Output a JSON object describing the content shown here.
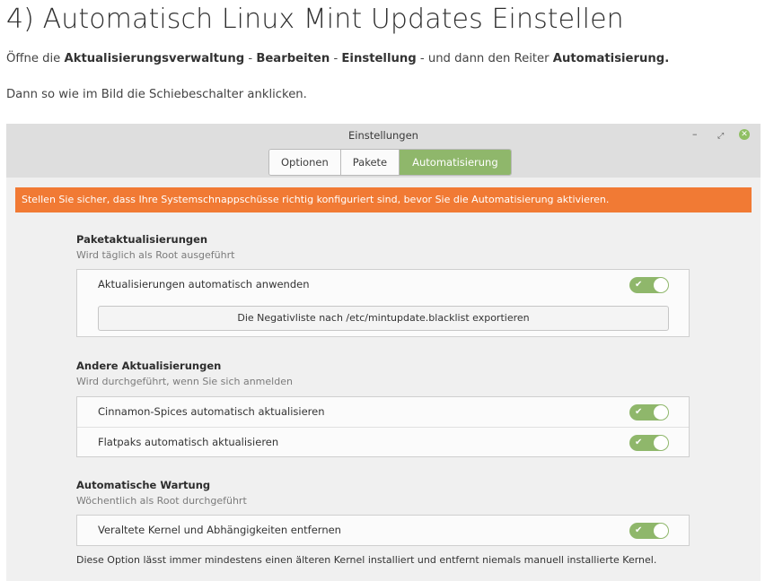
{
  "article": {
    "heading": "4) Automatisch Linux Mint Updates Einstellen",
    "paragraph1": {
      "t1": "Öffne die ",
      "b1": "Aktualisierungsverwaltung",
      "t2": " -  ",
      "b2": "Bearbeiten",
      "t3": " - ",
      "b3": "Einstellung",
      "t4": " - und dann den Reiter ",
      "b4": "Automatisierung."
    },
    "paragraph2": "Dann so wie im Bild die Schiebeschalter anklicken."
  },
  "window": {
    "title": "Einstellungen",
    "controls": {
      "minimize": "–",
      "maximize": "⤢",
      "close": "✕"
    },
    "tabs": [
      {
        "label": "Optionen",
        "active": false
      },
      {
        "label": "Pakete",
        "active": false
      },
      {
        "label": "Automatisierung",
        "active": true
      }
    ],
    "warning": "Stellen Sie sicher, dass Ihre Systemschnappschüsse richtig konfiguriert sind, bevor Sie die Automatisierung aktivieren.",
    "sections": [
      {
        "title": "Paketaktualisierungen",
        "subtitle": "Wird täglich als Root ausgeführt",
        "rows": [
          {
            "label": "Aktualisierungen automatisch anwenden",
            "enabled": true
          }
        ],
        "button": "Die Negativliste nach /etc/mintupdate.blacklist exportieren"
      },
      {
        "title": "Andere Aktualisierungen",
        "subtitle": "Wird durchgeführt, wenn Sie sich anmelden",
        "rows": [
          {
            "label": "Cinnamon-Spices automatisch aktualisieren",
            "enabled": true
          },
          {
            "label": "Flatpaks automatisch aktualisieren",
            "enabled": true
          }
        ]
      },
      {
        "title": "Automatische Wartung",
        "subtitle": "Wöchentlich als Root durchgeführt",
        "rows": [
          {
            "label": "Veraltete Kernel und Abhängigkeiten entfernen",
            "enabled": true
          }
        ],
        "note": "Diese Option lässt immer mindestens einen älteren Kernel installiert und entfernt niemals manuell installierte Kernel."
      }
    ],
    "switch_icon": "✔",
    "colors": {
      "accent": "#8fb76b",
      "warning": "#f17a34",
      "close": "#8fbf63"
    }
  }
}
